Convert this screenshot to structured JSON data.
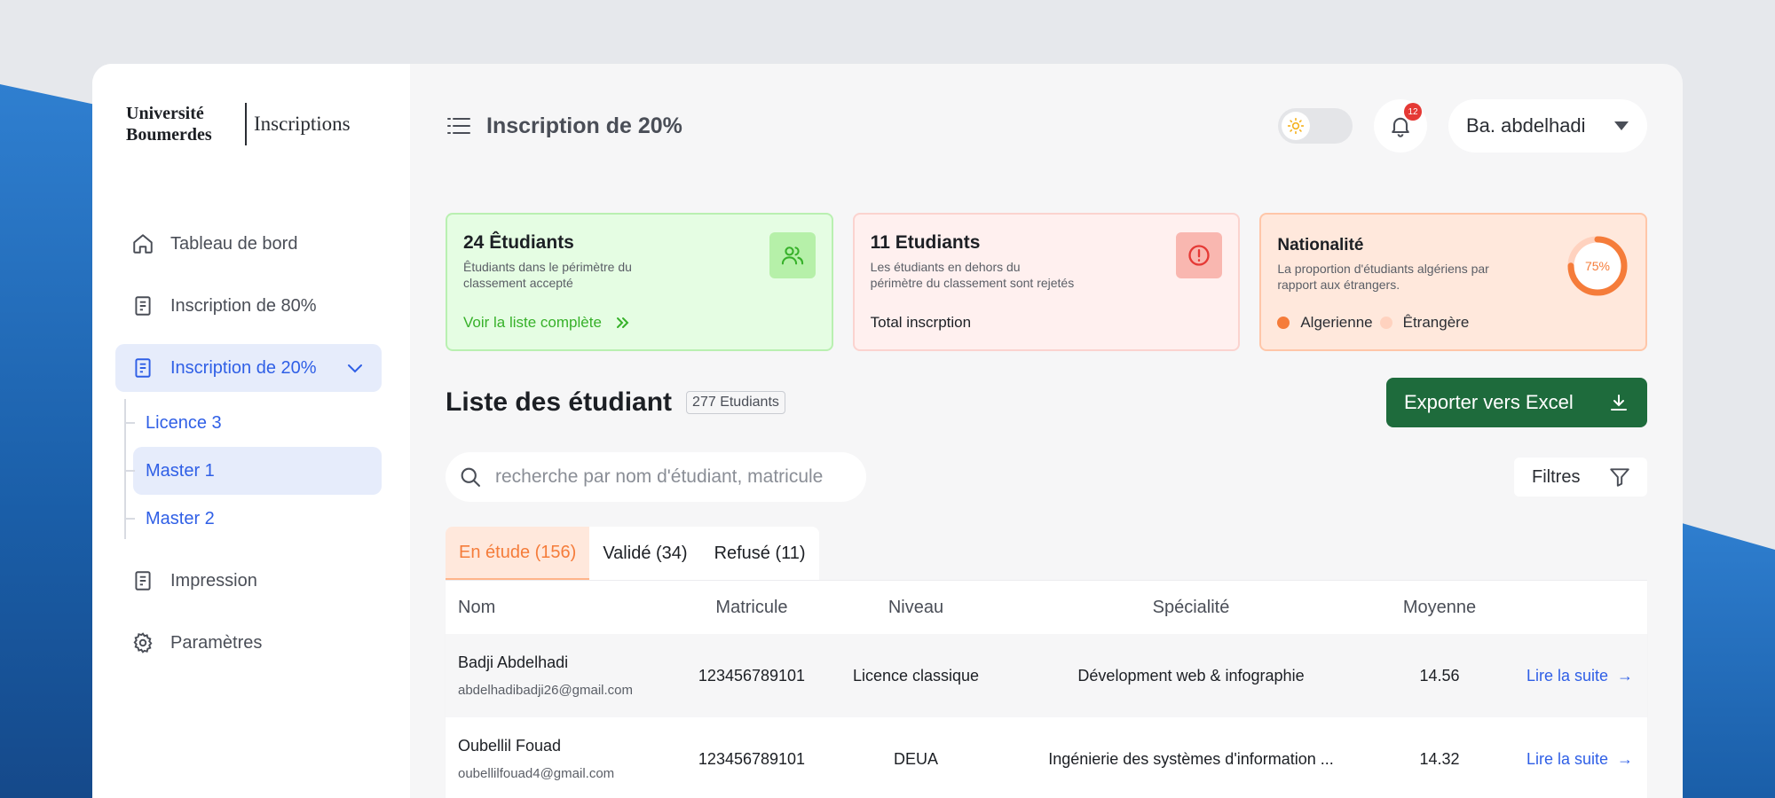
{
  "brand": {
    "university": "Université Boumerdes",
    "app": "Inscriptions"
  },
  "sidebar": {
    "items": [
      {
        "label": "Tableau de bord",
        "icon": "home-icon"
      },
      {
        "label": "Inscription de 80%",
        "icon": "document-icon"
      },
      {
        "label": "Inscription de 20%",
        "icon": "document-icon",
        "active": true,
        "children": [
          {
            "label": "Licence 3"
          },
          {
            "label": "Master 1",
            "active": true
          },
          {
            "label": "Master 2"
          }
        ]
      },
      {
        "label": "Impression",
        "icon": "document-icon"
      },
      {
        "label": "Paramètres",
        "icon": "gear-icon"
      }
    ]
  },
  "header": {
    "title": "Inscription de 20%",
    "notifications": "12",
    "user": "Ba. abdelhadi"
  },
  "cards": {
    "accepted": {
      "title": "24 Êtudiants",
      "desc": "Êtudiants dans le périmètre du classement accepté",
      "link": "Voir la liste complète"
    },
    "rejected": {
      "title": "11 Etudiants",
      "desc": "Les étudiants en dehors du périmètre du classement sont rejetés",
      "footer": "Total inscrption"
    },
    "nationality": {
      "title": "Nationalité",
      "desc": "La proportion d'étudiants algériens par rapport aux étrangers.",
      "percent_label": "75%",
      "percent": 75,
      "legend": [
        "Algerienne",
        "Êtrangère"
      ]
    }
  },
  "list": {
    "title": "Liste des étudiant",
    "count": "277 Etudiants",
    "export": "Exporter vers Excel",
    "search_placeholder": "recherche par nom d'étudiant, matricule",
    "filters": "Filtres",
    "tabs": [
      "En étude (156)",
      "Validé (34)",
      "Refusé (11)"
    ],
    "columns": [
      "Nom",
      "Matricule",
      "Niveau",
      "Spécialité",
      "Moyenne"
    ],
    "rows": [
      {
        "name": "Badji Abdelhadi",
        "email": "abdelhadibadji26@gmail.com",
        "matricule": "123456789101",
        "niveau": "Licence classique",
        "specialite": "Dévelopment web & infographie",
        "moyenne": "14.56",
        "action": "Lire la suite"
      },
      {
        "name": "Oubellil Fouad",
        "email": "oubellilfouad4@gmail.com",
        "matricule": "123456789101",
        "niveau": "DEUA",
        "specialite": "Ingénierie des systèmes d'information ...",
        "moyenne": "14.32",
        "action": "Lire la suite"
      }
    ]
  },
  "colors": {
    "accent": "#2f5fe6",
    "export": "#1e6b3c",
    "orange": "#f57c3a",
    "green": "#37b12a",
    "red": "#e53935"
  }
}
